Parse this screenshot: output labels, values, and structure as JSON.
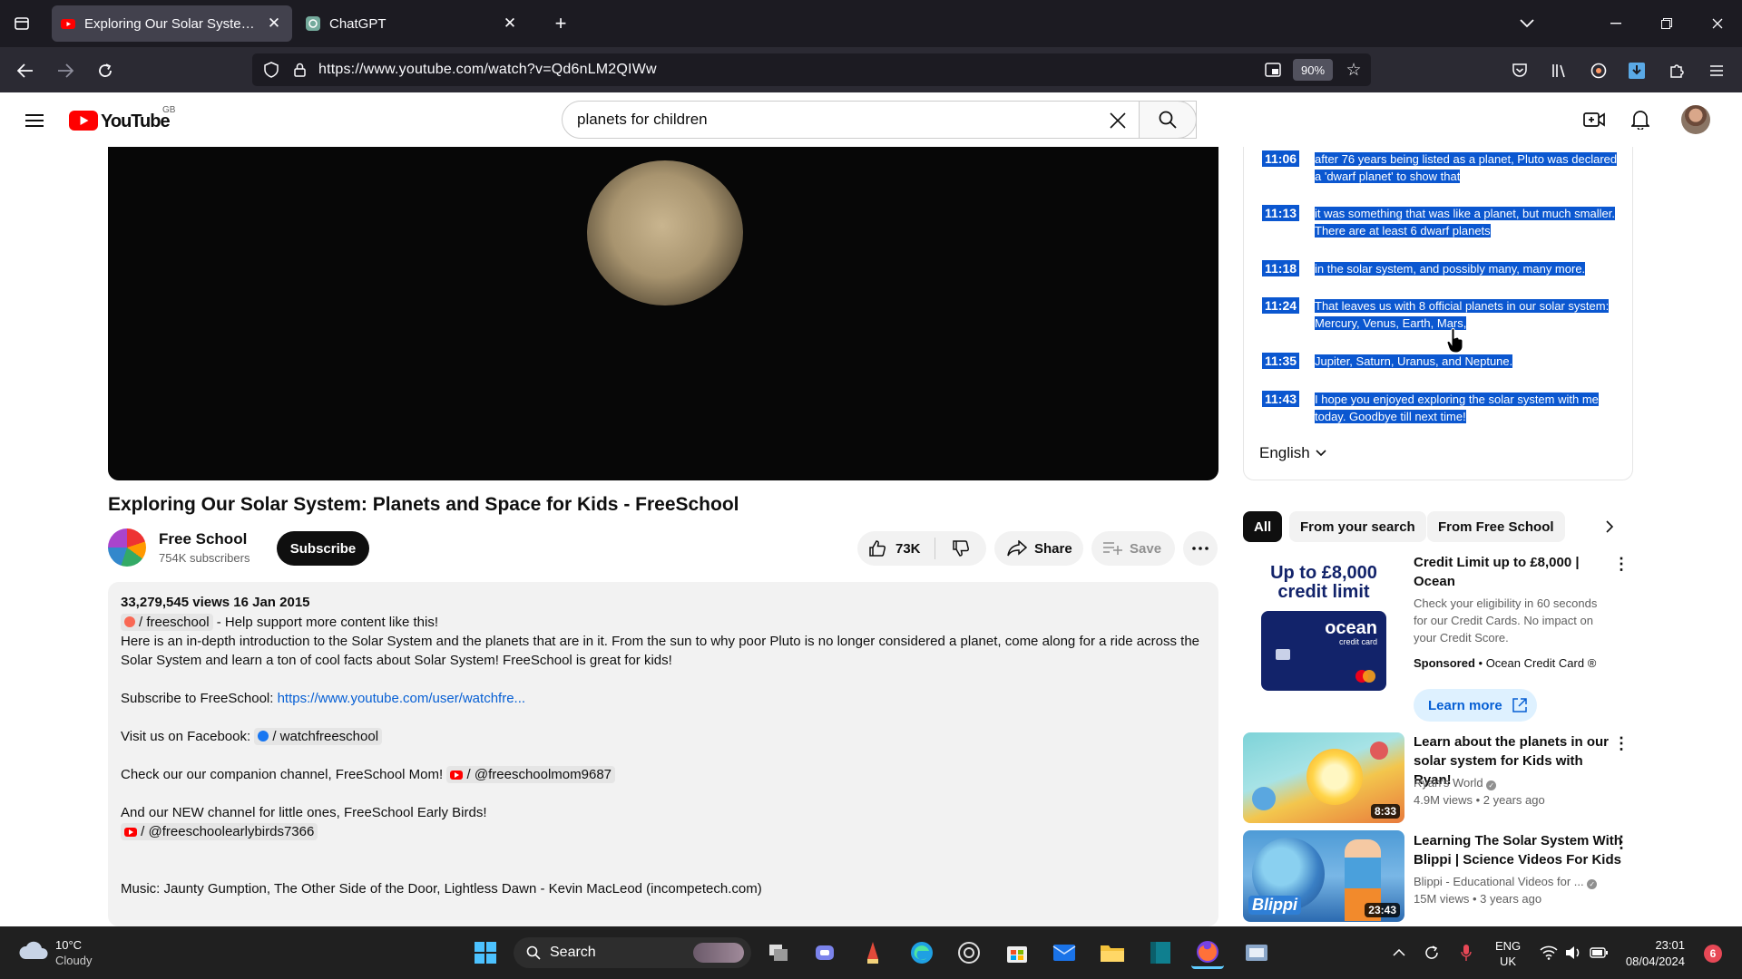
{
  "browser": {
    "tabs": [
      {
        "title": "Exploring Our Solar System: Pla",
        "active": true
      },
      {
        "title": "ChatGPT",
        "active": false
      }
    ],
    "url": "https://www.youtube.com/watch?v=Qd6nLM2QIWw",
    "zoom": "90%"
  },
  "youtube": {
    "region": "GB",
    "search_value": "planets for children"
  },
  "video": {
    "title": "Exploring Our Solar System: Planets and Space for Kids - FreeSchool",
    "channel": "Free School",
    "subscribers": "754K subscribers",
    "subscribe_label": "Subscribe",
    "likes": "73K",
    "share_label": "Share",
    "save_label": "Save"
  },
  "description": {
    "views_date": "33,279,545 views  16 Jan 2015",
    "patreon_handle": "/ freeschool",
    "patreon_suffix": " - Help support more content like this!",
    "line1": "Here is an in-depth introduction to the Solar System and the planets that are in it. From the sun to why poor Pluto is no longer considered a planet, come along for a ride across the",
    "line2": "Solar System and learn a ton of cool facts about Solar System! FreeSchool is great for kids!",
    "subscribe_prefix": "Subscribe to FreeSchool: ",
    "subscribe_link": "https://www.youtube.com/user/watchfre...",
    "facebook_prefix": "Visit us on Facebook: ",
    "facebook_handle": "/ watchfreeschool",
    "companion_prefix": "Check our our companion channel, FreeSchool Mom! ",
    "companion_handle": "/ @freeschoolmom9687",
    "earlybirds_text": "And our NEW channel for little ones, FreeSchool Early Birds!",
    "earlybirds_handle": "/ @freeschoolearlybirds7366",
    "music": "Music: Jaunty Gumption, The Other Side of the Door, Lightless Dawn - Kevin MacLeod (incompetech.com)"
  },
  "transcript": {
    "segments": [
      {
        "time": "11:06",
        "l1": "after 76 years being listed as a planet, Pluto was declared",
        "l2": "a 'dwarf planet' to show that"
      },
      {
        "time": "11:13",
        "l1": "it was something that was like a planet, but much smaller.",
        "l2": "There are at least 6 dwarf planets"
      },
      {
        "time": "11:18",
        "l1": "in the solar system, and possibly many, many more.",
        "l2": ""
      },
      {
        "time": "11:24",
        "l1": "That leaves us with 8 official planets in our solar system:",
        "l2": "Mercury, Venus, Earth, Mars,"
      },
      {
        "time": "11:35",
        "l1": "Jupiter, Saturn, Uranus, and Neptune.",
        "l2": ""
      },
      {
        "time": "11:43",
        "l1": "I hope you enjoyed exploring the solar system with me",
        "l2": "today. Goodbye till next time!"
      }
    ],
    "language": "English"
  },
  "filters": [
    "All",
    "From your search",
    "From Free School"
  ],
  "ad": {
    "img_line1": "Up to £8,000",
    "img_line2": "credit limit",
    "card_brand": "ocean",
    "card_sub": "credit card",
    "title": "Credit Limit up to £8,000 | Ocean",
    "body": "Check your eligibility in 60 seconds for our Credit Cards. No impact on your Credit Score.",
    "sponsored": "Sponsored",
    "advertiser": "Ocean Credit Card",
    "cta": "Learn more"
  },
  "related": [
    {
      "title": "Learn about the planets in our solar system for Kids with Ryan!",
      "channel": "Ryan's World",
      "meta": "4.9M views • 2 years ago",
      "duration": "8:33"
    },
    {
      "title": "Learning The Solar System With Blippi | Science Videos For Kids",
      "channel": "Blippi - Educational Videos for ...",
      "meta": "15M views • 3 years ago",
      "duration": "23:43",
      "thumb_label": "Blippi"
    }
  ],
  "taskbar": {
    "temp": "10°C",
    "weather": "Cloudy",
    "search_label": "Search",
    "lang1": "ENG",
    "lang2": "UK",
    "time": "23:01",
    "date": "08/04/2024",
    "notifications": "6"
  },
  "colors": {
    "selection": "#0b57d0",
    "yt_red": "#ff0000",
    "link": "#065fd4"
  }
}
